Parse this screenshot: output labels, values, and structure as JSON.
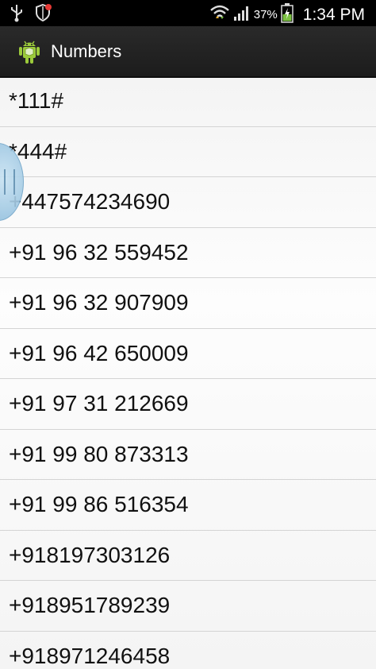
{
  "status_bar": {
    "icons": [
      "usb-icon",
      "shield-icon",
      "wifi-icon",
      "signal-icon",
      "battery-charging-icon"
    ],
    "battery": "37%",
    "time": "1:34 PM"
  },
  "action_bar": {
    "title": "Numbers",
    "icon": "android-icon"
  },
  "numbers": [
    "*111#",
    "*444#",
    "+447574234690",
    "+91 96 32 559452",
    "+91 96 32 907909",
    "+91 96 42 650009",
    "+91 97 31 212669",
    "+91 99 80 873313",
    "+91 99 86 516354",
    "+918197303126",
    "+918951789239",
    "+918971246458"
  ]
}
